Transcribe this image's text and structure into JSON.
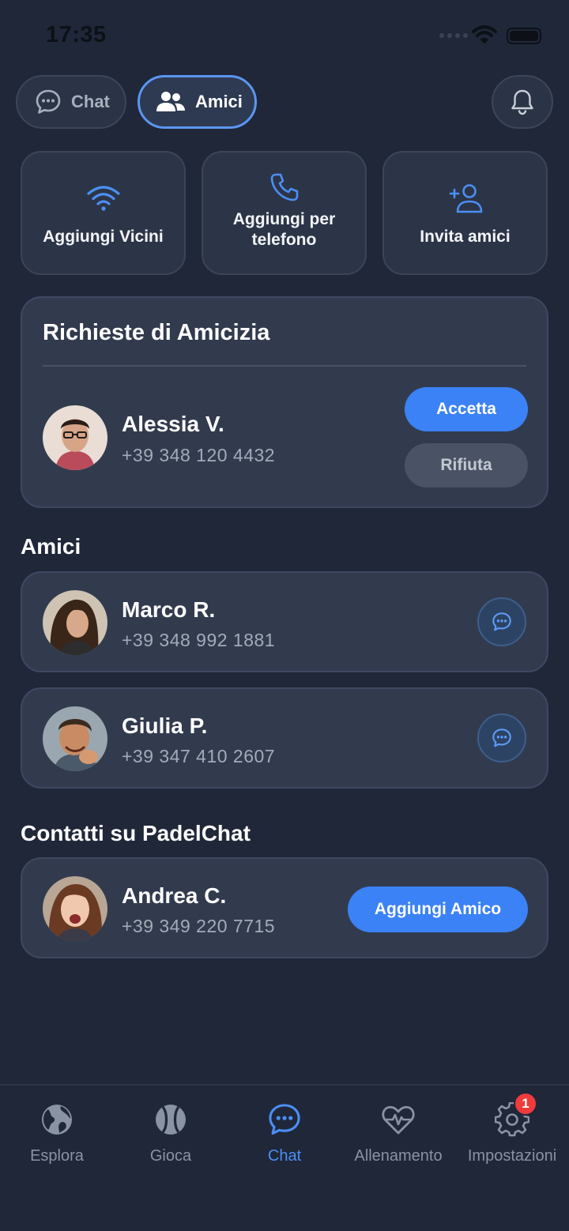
{
  "status_bar": {
    "time": "17:35"
  },
  "segment": {
    "chat_label": "Chat",
    "amici_label": "Amici",
    "active": "Amici"
  },
  "actions": [
    {
      "label": "Aggiungi Vicini",
      "icon": "wifi-icon"
    },
    {
      "label": "Aggiungi per telefono",
      "icon": "phone-icon"
    },
    {
      "label": "Invita amici",
      "icon": "add-user-icon"
    }
  ],
  "requests": {
    "title": "Richieste di Amicizia",
    "items": [
      {
        "name": "Alessia V.",
        "phone": "+39 348 120 4432",
        "accept_label": "Accetta",
        "reject_label": "Rifiuta"
      }
    ]
  },
  "friends": {
    "title": "Amici",
    "items": [
      {
        "name": "Marco R.",
        "phone": "+39 348 992 1881"
      },
      {
        "name": "Giulia P.",
        "phone": "+39 347 410 2607"
      }
    ]
  },
  "contacts": {
    "title": "Contatti su PadelChat",
    "items": [
      {
        "name": "Andrea C.",
        "phone": "+39 349 220 7715",
        "add_label": "Aggiungi Amico"
      }
    ]
  },
  "tabbar": {
    "items": [
      {
        "label": "Esplora",
        "icon": "globe-icon"
      },
      {
        "label": "Gioca",
        "icon": "tennis-ball-icon"
      },
      {
        "label": "Chat",
        "icon": "chat-bubble-icon",
        "active": true
      },
      {
        "label": "Allenamento",
        "icon": "heart-pulse-icon"
      },
      {
        "label": "Impostazioni",
        "icon": "gear-icon",
        "badge": "1"
      }
    ]
  },
  "colors": {
    "background": "#1f2739",
    "card": "#323b4e",
    "accent": "#3b82f6",
    "badge": "#ef3b3b"
  }
}
